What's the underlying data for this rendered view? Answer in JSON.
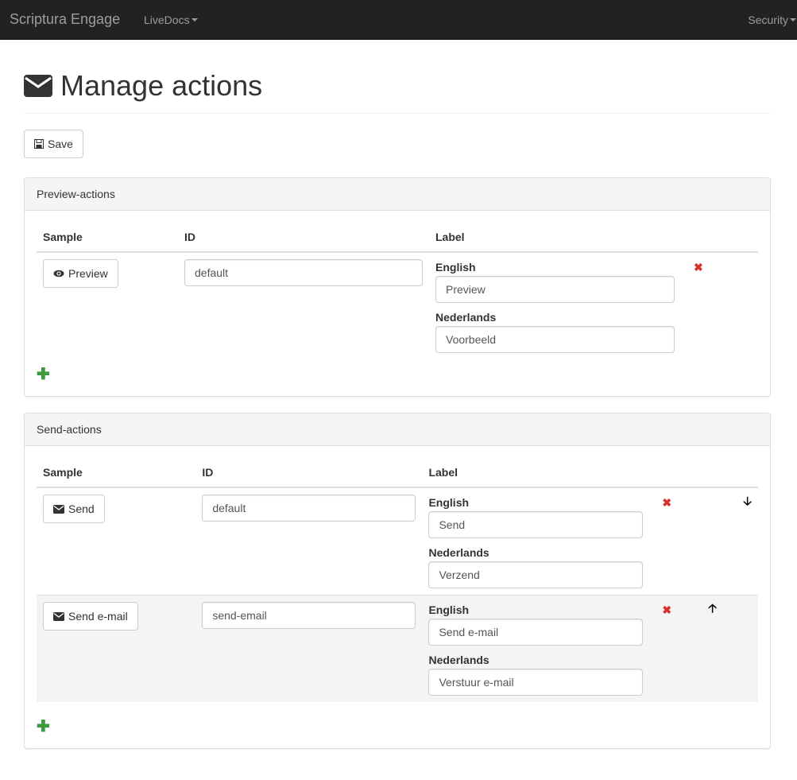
{
  "navbar": {
    "brand": "Scriptura Engage",
    "menus": [
      {
        "label": "LiveDocs"
      },
      {
        "label": "Security"
      }
    ]
  },
  "page": {
    "title": "Manage actions",
    "title_icon": "envelope-icon",
    "save_label": "Save",
    "save_icon": "floppy-disk-icon"
  },
  "panels": [
    {
      "heading": "Preview-actions",
      "columns": {
        "sample": "Sample",
        "id": "ID",
        "label": "Label"
      },
      "rows": [
        {
          "sample_label": "Preview",
          "sample_icon": "eye-icon",
          "id_value": "default",
          "labels": [
            {
              "language": "English",
              "value": "Preview"
            },
            {
              "language": "Nederlands",
              "value": "Voorbeeld"
            }
          ],
          "remove_icon": "remove-icon"
        }
      ],
      "add_icon": "plus-icon"
    },
    {
      "heading": "Send-actions",
      "columns": {
        "sample": "Sample",
        "id": "ID",
        "label": "Label"
      },
      "rows": [
        {
          "sample_label": "Send",
          "sample_icon": "envelope-icon",
          "id_value": "default",
          "labels": [
            {
              "language": "English",
              "value": "Send"
            },
            {
              "language": "Nederlands",
              "value": "Verzend"
            }
          ],
          "remove_icon": "remove-icon",
          "move_icon": "arrow-down-icon"
        },
        {
          "sample_label": "Send e-mail",
          "sample_icon": "envelope-icon",
          "id_value": "send-email",
          "labels": [
            {
              "language": "English",
              "value": "Send e-mail"
            },
            {
              "language": "Nederlands",
              "value": "Verstuur e-mail"
            }
          ],
          "remove_icon": "remove-icon",
          "move_icon": "arrow-up-icon"
        }
      ],
      "add_icon": "plus-icon"
    }
  ],
  "colors": {
    "navbar_bg": "#222222",
    "remove": "#d9302c",
    "add": "#3c9a3c"
  }
}
